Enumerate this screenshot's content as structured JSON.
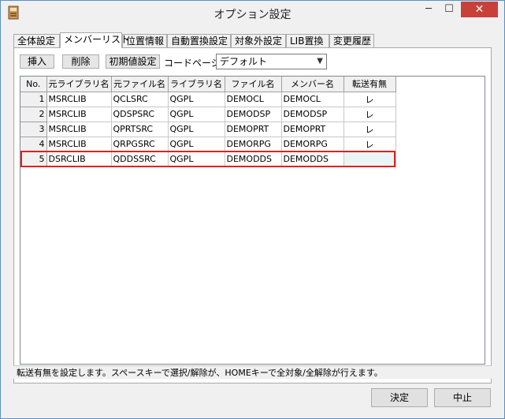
{
  "window": {
    "title": "オプション設定",
    "min_glyph": "─",
    "max_glyph": "☐",
    "close_glyph": "✕"
  },
  "tabs": [
    {
      "label": "全体設定",
      "active": false
    },
    {
      "label": "メンバーリスト",
      "active": true
    },
    {
      "label": "位置情報",
      "active": false
    },
    {
      "label": "自動置換設定",
      "active": false
    },
    {
      "label": "対象外設定",
      "active": false
    },
    {
      "label": "LIB置換",
      "active": false
    },
    {
      "label": "変更履歴",
      "active": false
    }
  ],
  "toolbar": {
    "insert_label": "挿入",
    "delete_label": "削除",
    "reset_label": "初期値設定",
    "codepage_label": "コードページ",
    "codepage_value": "デフォルト"
  },
  "table": {
    "columns": [
      "No.",
      "元ライブラリ名",
      "元ファイル名",
      "ライブラリ名",
      "ファイル名",
      "メンバー名",
      "転送有無"
    ],
    "rows": [
      [
        "1",
        "MSRCLIB",
        "QCLSRC",
        "QGPL",
        "DEMOCL",
        "DEMOCL",
        "レ"
      ],
      [
        "2",
        "MSRCLIB",
        "QDSPSRC",
        "QGPL",
        "DEMODSP",
        "DEMODSP",
        "レ"
      ],
      [
        "3",
        "MSRCLIB",
        "QPRTSRC",
        "QGPL",
        "DEMOPRT",
        "DEMOPRT",
        "レ"
      ],
      [
        "4",
        "MSRCLIB",
        "QRPGSRC",
        "QGPL",
        "DEMORPG",
        "DEMORPG",
        "レ"
      ],
      [
        "5",
        "DSRCLIB",
        "QDDSSRC",
        "QGPL",
        "DEMODDS",
        "DEMODDS",
        ""
      ]
    ],
    "selected_row": 5,
    "highlight_color": "#e02020"
  },
  "status_text": "転送有無を設定します。スペースキーで選択/解除が、HOMEキーで全対象/全解除が行えます。",
  "buttons": {
    "ok_label": "決定",
    "cancel_label": "中止"
  }
}
